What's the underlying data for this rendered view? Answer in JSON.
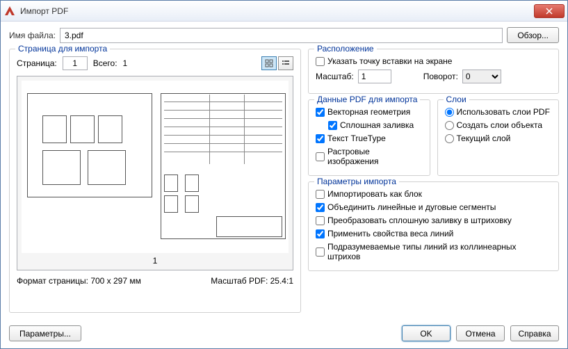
{
  "window": {
    "title": "Импорт PDF"
  },
  "file": {
    "label": "Имя файла:",
    "value": "3.pdf",
    "browse": "Обзор..."
  },
  "page_group": {
    "title": "Страница для импорта",
    "page_label": "Страница:",
    "page_value": "1",
    "total_label": "Всего:",
    "total_value": "1",
    "preview_page_num": "1",
    "format_label": "Формат страницы:",
    "format_value": "700 x  297 мм",
    "scale_label": "Масштаб PDF:",
    "scale_value": "25.4:1"
  },
  "location": {
    "title": "Расположение",
    "insert_point": "Указать точку вставки на экране",
    "scale_label": "Масштаб:",
    "scale_value": "1",
    "rotation_label": "Поворот:",
    "rotation_value": "0"
  },
  "pdf_data": {
    "title": "Данные PDF для импорта",
    "vector": "Векторная геометрия",
    "solid_fill": "Сплошная заливка",
    "truetype": "Текст TrueType",
    "raster": "Растровые изображения"
  },
  "layers": {
    "title": "Слои",
    "use_pdf": "Использовать слои PDF",
    "create_obj": "Создать слои объекта",
    "current": "Текущий слой"
  },
  "import_opts": {
    "title": "Параметры импорта",
    "as_block": "Импортировать как блок",
    "join_segments": "Объединить линейные и дуговые сегменты",
    "convert_fill": "Преобразовать сплошную заливку в штриховку",
    "lineweight": "Применить свойства веса линий",
    "infer_linetypes": "Подразумеваемые типы линий из коллинеарных штрихов"
  },
  "footer": {
    "options": "Параметры...",
    "ok": "OK",
    "cancel": "Отмена",
    "help": "Справка"
  }
}
